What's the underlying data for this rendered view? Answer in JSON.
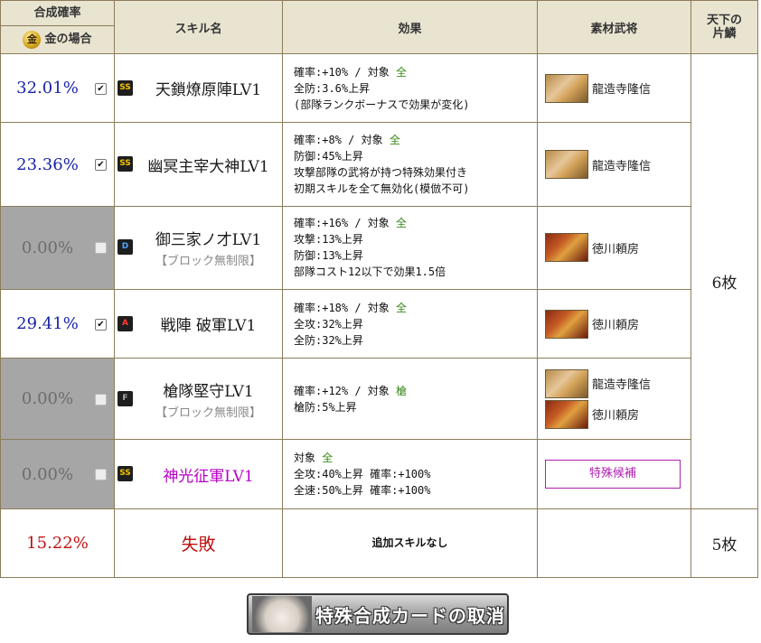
{
  "header": {
    "rate_label": "合成確率",
    "gold_case_label": "金の場合",
    "coin_char": "金",
    "skill_label": "スキル名",
    "effect_label": "効果",
    "material_label": "素材武将",
    "tenka_label_1": "天下の",
    "tenka_label_2": "片鱗"
  },
  "rows": [
    {
      "rate": "32.01%",
      "checked": true,
      "rank": "SS",
      "skill": "天鎖燎原陣LV1",
      "block": "",
      "effect": {
        "l1_prefix": "確率:+10% / 対象 ",
        "l1_target": "全",
        "l2": "全防:3.6%上昇",
        "l3": "(部隊ランクボーナスで効果が変化)",
        "l4": ""
      },
      "materials": [
        {
          "name": "龍造寺隆信"
        }
      ]
    },
    {
      "rate": "23.36%",
      "checked": true,
      "rank": "SS",
      "skill": "幽冥主宰大神LV1",
      "block": "",
      "effect": {
        "l1_prefix": "確率:+8% / 対象 ",
        "l1_target": "全",
        "l2": "防御:45%上昇",
        "l3": "攻撃部隊の武将が持つ特殊効果付き",
        "l4": "初期スキルを全て無効化(模倣不可)"
      },
      "materials": [
        {
          "name": "龍造寺隆信"
        }
      ]
    },
    {
      "rate": "0.00%",
      "checked": false,
      "rank": "D",
      "skill": "御三家ノ才LV1",
      "block": "【ブロック無制限】",
      "effect": {
        "l1_prefix": "確率:+16% / 対象 ",
        "l1_target": "全",
        "l2": "攻撃:13%上昇",
        "l3": "防御:13%上昇",
        "l4": "部隊コスト12以下で効果1.5倍"
      },
      "materials": [
        {
          "name": "徳川頼房"
        }
      ]
    },
    {
      "rate": "29.41%",
      "checked": true,
      "rank": "A",
      "skill": "戦陣 破軍LV1",
      "block": "",
      "effect": {
        "l1_prefix": "確率:+18% / 対象 ",
        "l1_target": "全",
        "l2": "全攻:32%上昇",
        "l3": "全防:32%上昇",
        "l4": ""
      },
      "materials": [
        {
          "name": "徳川頼房"
        }
      ]
    },
    {
      "rate": "0.00%",
      "checked": false,
      "rank": "F",
      "skill": "槍隊堅守LV1",
      "block": "【ブロック無制限】",
      "effect": {
        "l1_prefix": "確率:+12% / 対象 ",
        "l1_target": "槍",
        "l2": "槍防:5%上昇",
        "l3": "",
        "l4": ""
      },
      "materials": [
        {
          "name": "龍造寺隆信"
        },
        {
          "name": "徳川頼房"
        }
      ]
    },
    {
      "rate": "0.00%",
      "checked": false,
      "rank": "SS",
      "skill": "神光征軍LV1",
      "block": "",
      "effect": {
        "l1_prefix": "対象 ",
        "l1_target": "全",
        "l2": "全攻:40%上昇 確率:+100%",
        "l3": "全速:50%上昇 確率:+100%",
        "l4": ""
      },
      "special_button": "特殊候補"
    }
  ],
  "fail_row": {
    "rate": "15.22%",
    "label": "失敗",
    "effect": "追加スキルなし",
    "tenka": "5枚"
  },
  "tenka_merged": "6枚",
  "cancel_button": "特殊合成カードの取消",
  "colors": {
    "rate_blue": "#1a24a8",
    "fail_red": "#c01010",
    "header_bg": "#e8e4d0",
    "border": "#8c7d5a",
    "special_purple": "#b020b0",
    "target_green": "#3a8a1a"
  }
}
